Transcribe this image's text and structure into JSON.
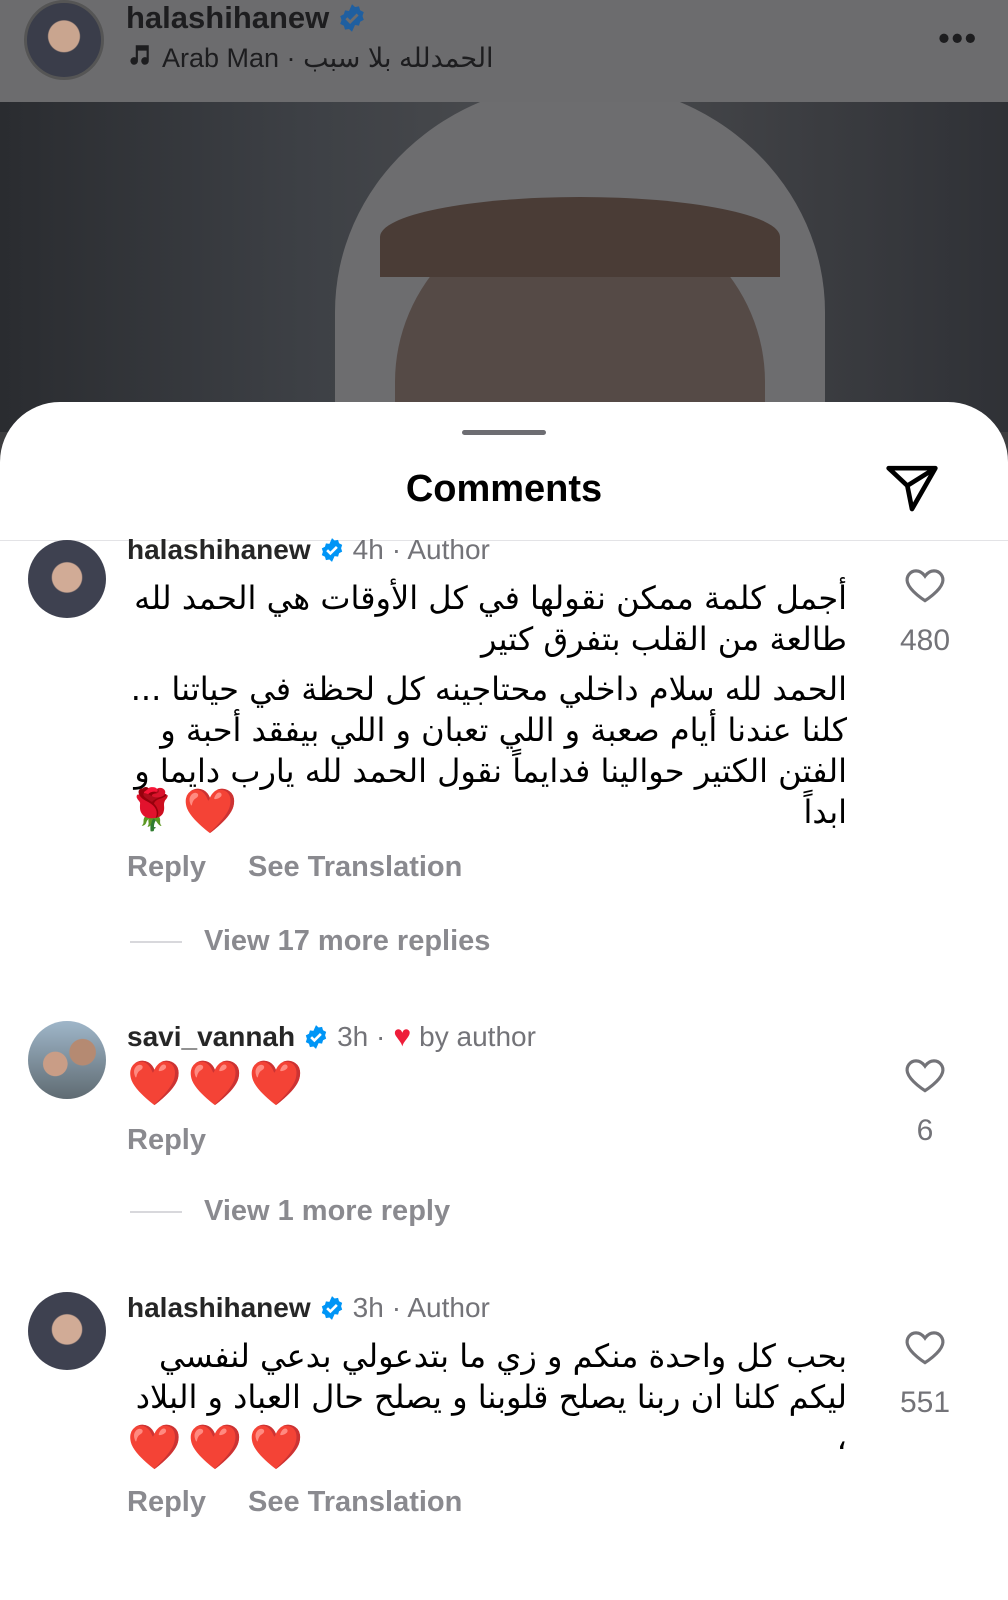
{
  "post_header": {
    "username": "halashihanew",
    "audio_label": "Arab Man · الحمدلله بلا سبب",
    "more_label": "•••"
  },
  "sheet": {
    "title": "Comments"
  },
  "comments": [
    {
      "username": "halashihanew",
      "time": "4h",
      "tag": "· Author",
      "text_lines": [
        "أجمل كلمة ممكن نقولها في كل الأوقات هي الحمد لله",
        "طالعة من القلب بتفرق كتير"
      ],
      "text_lines_2": [
        "الحمد لله سلام داخلي محتاجينه كل لحظة في حياتنا ...",
        "كلنا عندنا أيام صعبة و اللي تعبان و اللي بيفقد أحبة  و",
        "الفتن الكتير حوالينا فدايماً نقول الحمد لله يارب دايما و",
        "ابداً"
      ],
      "emoji": [
        "❤️",
        "🌹"
      ],
      "likes": "480",
      "reply_label": "Reply",
      "translate_label": "See Translation",
      "view_replies": "View 17 more replies"
    },
    {
      "username": "savi_vannah",
      "time": "3h ·",
      "tag": "by author",
      "emoji": [
        "❤️",
        "❤️",
        "❤️"
      ],
      "likes": "6",
      "reply_label": "Reply",
      "view_replies": "View 1 more reply"
    },
    {
      "username": "halashihanew",
      "time": "3h",
      "tag": "· Author",
      "text_lines": [
        "بحب كل واحدة منكم و زي ما بتدعولي بدعي لنفسي",
        "ليكم كلنا ان ربنا يصلح قلوبنا و يصلح حال العباد و البلاد ،"
      ],
      "emoji": [
        "❤️",
        "❤️",
        "❤️"
      ],
      "likes": "551",
      "reply_label": "Reply",
      "translate_label": "See Translation"
    }
  ],
  "colors": {
    "verified_blue": "#0095f6",
    "like_red": "#ee1d3a",
    "secondary_text": "#737378"
  }
}
